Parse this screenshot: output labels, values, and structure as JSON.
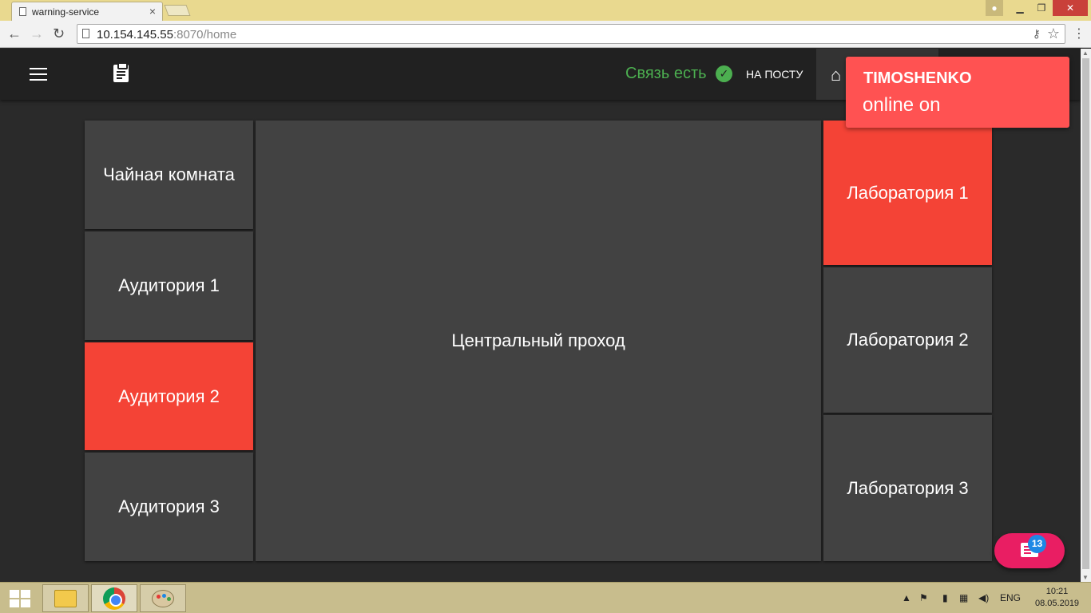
{
  "browser": {
    "tab_title": "warning-service",
    "tab_close": "×",
    "url_host": "10.154.145.55",
    "url_rest": ":8070/home",
    "window_min": "▁",
    "window_max": "❐",
    "window_close": "✕"
  },
  "appbar": {
    "status_text": "Связь есть",
    "post_label": "НА ПОСТУ"
  },
  "rooms": {
    "tea_room": "Чайная комната",
    "auditorium_1": "Аудитория 1",
    "auditorium_2": "Аудитория 2",
    "auditorium_3": "Аудитория 3",
    "central_corridor": "Центральный проход",
    "laboratory_1": "Лаборатория 1",
    "laboratory_2": "Лаборатория 2",
    "laboratory_3": "Лаборатория 3"
  },
  "room_states": {
    "auditorium_2": "alarm",
    "laboratory_1": "alarm"
  },
  "notification": {
    "title": "TIMOSHENKO",
    "body": "online on"
  },
  "fab": {
    "badge_count": "13"
  },
  "taskbar": {
    "language": "ENG",
    "time": "10:21",
    "date": "08.05.2019"
  },
  "colors": {
    "alarm": "#f44336",
    "room": "#424242",
    "status_ok": "#4caf50",
    "notification": "#ff5252",
    "fab": "#e91e63",
    "badge": "#1e88e5"
  }
}
